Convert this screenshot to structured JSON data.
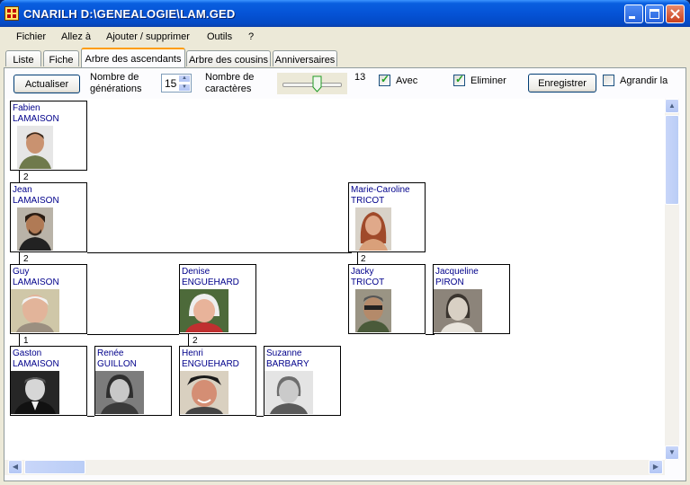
{
  "window": {
    "title": "CNARILH D:\\GENEALOGIE\\LAM.GED"
  },
  "menu": [
    "Fichier",
    "Allez à",
    "Ajouter / supprimer",
    "Outils",
    "?"
  ],
  "tabs": [
    {
      "label": "Liste",
      "active": false
    },
    {
      "label": "Fiche",
      "active": false
    },
    {
      "label": "Arbre des ascendants",
      "active": true
    },
    {
      "label": "Arbre des cousins",
      "active": false
    },
    {
      "label": "Anniversaires",
      "active": false
    }
  ],
  "toolbar": {
    "refresh_label": "Actualiser",
    "generations_label_1": "Nombre de",
    "generations_label_2": "générations",
    "generations_value": "15",
    "chars_label_1": "Nombre de",
    "chars_label_2": "caractères",
    "chars_value": "13",
    "chars_slider_level": 0.55,
    "avec_label": "Avec",
    "avec_checked": true,
    "eliminer_label": "Eliminer",
    "eliminer_checked": true,
    "save_label": "Enregistrer",
    "enlarge_label": "Agrandir la",
    "enlarge_checked": false
  },
  "tree": {
    "people": [
      {
        "first": "Fabien",
        "last": "LAMAISON"
      },
      {
        "first": "Jean",
        "last": "LAMAISON"
      },
      {
        "first": "Marie-Caroline",
        "last": "TRICOT"
      },
      {
        "first": "Guy",
        "last": "LAMAISON"
      },
      {
        "first": "Denise",
        "last": "ENGUEHARD"
      },
      {
        "first": "Jacky",
        "last": "TRICOT"
      },
      {
        "first": "Jacqueline",
        "last": "PIRON"
      },
      {
        "first": "Gaston",
        "last": "LAMAISON"
      },
      {
        "first": "Renée",
        "last": "GUILLON"
      },
      {
        "first": "Henri",
        "last": "ENGUEHARD"
      },
      {
        "first": "Suzanne",
        "last": "BARBARY"
      }
    ],
    "numbers": [
      "2",
      "2",
      "2",
      "1",
      "2"
    ]
  },
  "colors": {
    "name_text": "#00008b",
    "tab_highlight": "#ff9c00",
    "title_bar": "#0553d6"
  }
}
